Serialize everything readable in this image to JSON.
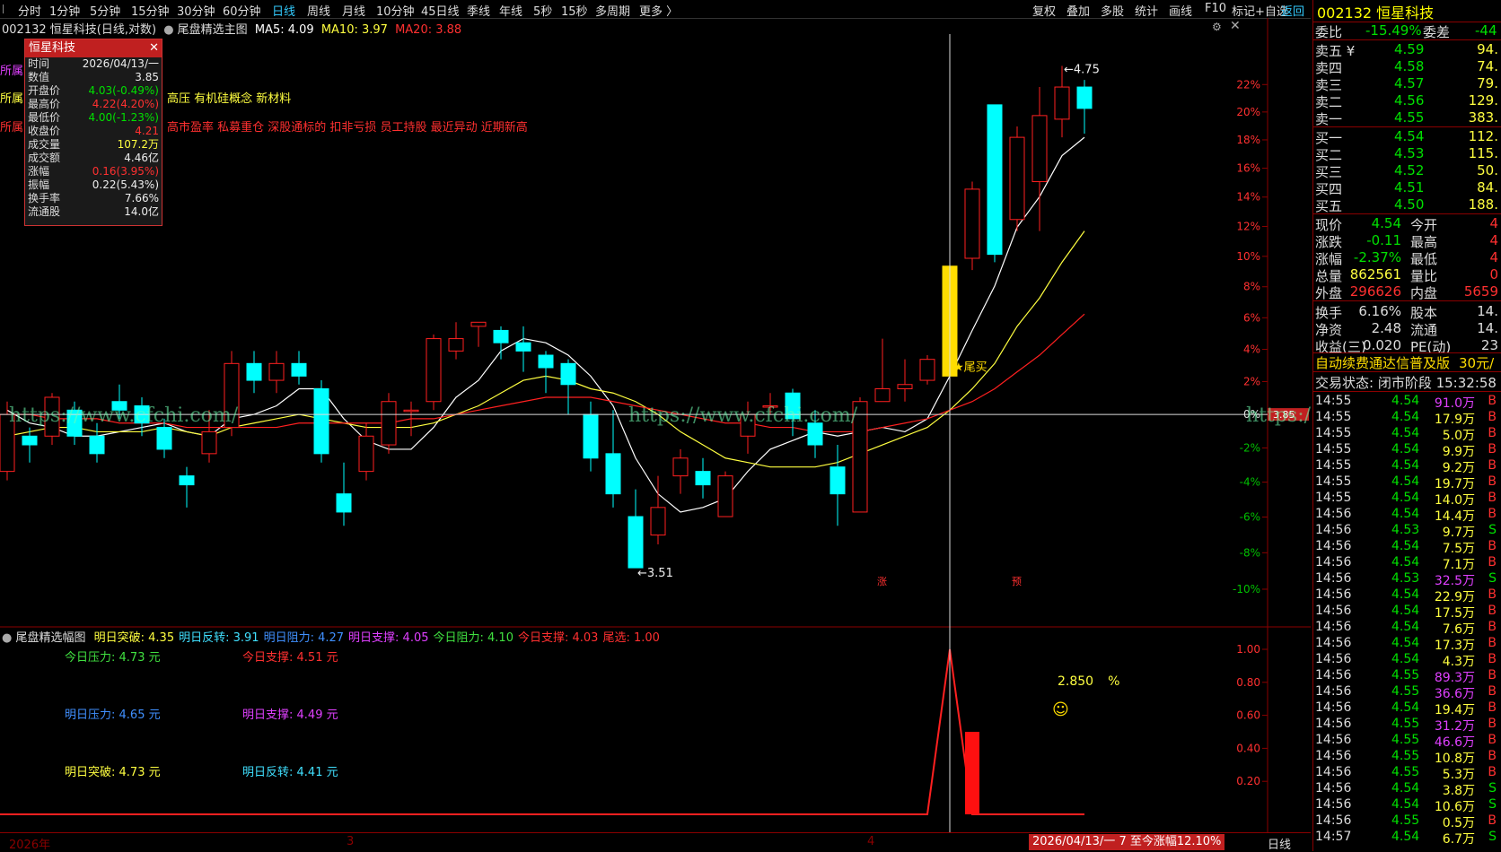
{
  "toolbar": {
    "periods": [
      "分时",
      "1分钟",
      "5分钟",
      "15分钟",
      "30分钟",
      "60分钟",
      "日线",
      "周线",
      "月线",
      "10分钟",
      "45日线",
      "季线",
      "年线",
      "5秒",
      "15秒",
      "多周期",
      "更多 〉"
    ],
    "active_index": 6,
    "right_items": [
      "复权",
      "叠加",
      "多股",
      "统计",
      "画线",
      "F10",
      "标记+自选",
      "返回"
    ]
  },
  "main": {
    "info": {
      "code_name": "002132 恒星科技(日线,对数)",
      "indicator": "尾盘精选主图",
      "ma5": "MA5: 4.09",
      "ma10": "MA10: 3.97",
      "ma20": "MA20: 3.88"
    },
    "popup": {
      "title": "恒星科技",
      "rows": [
        {
          "label": "时间",
          "value": "2026/04/13/一",
          "color": "#eee"
        },
        {
          "label": "数值",
          "value": "3.85",
          "color": "#eee"
        },
        {
          "label": "开盘价",
          "value": "4.03(-0.49%)",
          "color": "#00e000"
        },
        {
          "label": "最高价",
          "value": "4.22(4.20%)",
          "color": "#ff3030"
        },
        {
          "label": "最低价",
          "value": "4.00(-1.23%)",
          "color": "#00e000"
        },
        {
          "label": "收盘价",
          "value": "4.21",
          "color": "#ff3030"
        },
        {
          "label": "成交量",
          "value": "107.2万",
          "color": "#ffff40"
        },
        {
          "label": "成交额",
          "value": "4.46亿",
          "color": "#eee"
        },
        {
          "label": "涨幅",
          "value": "0.16(3.95%)",
          "color": "#ff3030"
        },
        {
          "label": "振幅",
          "value": "0.22(5.43%)",
          "color": "#eee"
        },
        {
          "label": "换手率",
          "value": "7.66%",
          "color": "#eee"
        },
        {
          "label": "流通股",
          "value": "14.0亿",
          "color": "#eee"
        }
      ]
    },
    "sector_lines": [
      {
        "text": "所属",
        "color": "#e040ff"
      },
      {
        "text": "所属",
        "color": "#ffff40",
        "suffix": "高压 有机硅概念 新材料"
      },
      {
        "text": "所属",
        "color": "#ff3030",
        "suffix": "高市盈率 私募重仓 深股通标的 扣非亏损 员工持股 最近异动 近期新高"
      }
    ],
    "high_label": "4.75",
    "low_label": "3.51",
    "buy_signal": "★尾买",
    "watermark": "https://www.cfchi.com/",
    "price_tag": "3.85",
    "marks": [
      "涨",
      "预"
    ],
    "y_axis_pct": [
      "22%",
      "20%",
      "18%",
      "16%",
      "14%",
      "12%",
      "10%",
      "8%",
      "6%",
      "4%",
      "2%",
      "0%",
      "-2%",
      "-4%",
      "-6%",
      "-8%",
      "-10%"
    ]
  },
  "chart_data": {
    "type": "candlestick",
    "title": "002132 恒星科技(日线,对数)",
    "xlabel": "",
    "ylabel": "",
    "candles": [
      {
        "o": 3.72,
        "c": 3.85,
        "h": 3.88,
        "l": 3.7
      },
      {
        "o": 3.8,
        "c": 3.78,
        "h": 3.82,
        "l": 3.74
      },
      {
        "o": 3.8,
        "c": 3.89,
        "h": 3.9,
        "l": 3.78
      },
      {
        "o": 3.86,
        "c": 3.8,
        "h": 3.88,
        "l": 3.78
      },
      {
        "o": 3.8,
        "c": 3.76,
        "h": 3.83,
        "l": 3.74
      },
      {
        "o": 3.88,
        "c": 3.86,
        "h": 3.92,
        "l": 3.84
      },
      {
        "o": 3.87,
        "c": 3.83,
        "h": 3.89,
        "l": 3.8
      },
      {
        "o": 3.82,
        "c": 3.77,
        "h": 3.84,
        "l": 3.75
      },
      {
        "o": 3.71,
        "c": 3.69,
        "h": 3.73,
        "l": 3.64
      },
      {
        "o": 3.76,
        "c": 3.81,
        "h": 3.86,
        "l": 3.74
      },
      {
        "o": 3.82,
        "c": 3.97,
        "h": 4.0,
        "l": 3.8
      },
      {
        "o": 3.97,
        "c": 3.93,
        "h": 4.0,
        "l": 3.9
      },
      {
        "o": 3.93,
        "c": 3.97,
        "h": 4.0,
        "l": 3.9
      },
      {
        "o": 3.97,
        "c": 3.94,
        "h": 4.0,
        "l": 3.92
      },
      {
        "o": 3.91,
        "c": 3.76,
        "h": 3.93,
        "l": 3.74
      },
      {
        "o": 3.67,
        "c": 3.63,
        "h": 3.74,
        "l": 3.6
      },
      {
        "o": 3.72,
        "c": 3.8,
        "h": 3.83,
        "l": 3.7
      },
      {
        "o": 3.78,
        "c": 3.88,
        "h": 3.9,
        "l": 3.76
      },
      {
        "o": 3.86,
        "c": 3.86,
        "h": 3.88,
        "l": 3.8
      },
      {
        "o": 3.88,
        "c": 4.03,
        "h": 4.04,
        "l": 3.86
      },
      {
        "o": 4.0,
        "c": 4.03,
        "h": 4.07,
        "l": 3.98
      },
      {
        "o": 4.06,
        "c": 4.07,
        "h": 4.07,
        "l": 4.01
      },
      {
        "o": 4.05,
        "c": 4.02,
        "h": 4.06,
        "l": 3.98
      },
      {
        "o": 4.02,
        "c": 4.0,
        "h": 4.06,
        "l": 3.95
      },
      {
        "o": 3.99,
        "c": 3.96,
        "h": 4.0,
        "l": 3.9
      },
      {
        "o": 3.97,
        "c": 3.92,
        "h": 3.98,
        "l": 3.85
      },
      {
        "o": 3.85,
        "c": 3.75,
        "h": 3.88,
        "l": 3.72
      },
      {
        "o": 3.76,
        "c": 3.67,
        "h": 3.86,
        "l": 3.64
      },
      {
        "o": 3.62,
        "c": 3.51,
        "h": 3.68,
        "l": 3.51
      },
      {
        "o": 3.58,
        "c": 3.64,
        "h": 3.71,
        "l": 3.56
      },
      {
        "o": 3.71,
        "c": 3.75,
        "h": 3.77,
        "l": 3.67
      },
      {
        "o": 3.72,
        "c": 3.69,
        "h": 3.75,
        "l": 3.66
      },
      {
        "o": 3.62,
        "c": 3.71,
        "h": 3.72,
        "l": 3.62
      },
      {
        "o": 3.8,
        "c": 3.85,
        "h": 3.88,
        "l": 3.76
      },
      {
        "o": 3.87,
        "c": 3.87,
        "h": 3.9,
        "l": 3.85
      },
      {
        "o": 3.9,
        "c": 3.84,
        "h": 3.91,
        "l": 3.8
      },
      {
        "o": 3.83,
        "c": 3.78,
        "h": 3.86,
        "l": 3.75
      },
      {
        "o": 3.73,
        "c": 3.67,
        "h": 3.78,
        "l": 3.6
      },
      {
        "o": 3.63,
        "c": 3.88,
        "h": 3.89,
        "l": 3.63
      },
      {
        "o": 3.88,
        "c": 3.91,
        "h": 4.03,
        "l": 3.88
      },
      {
        "o": 3.91,
        "c": 3.92,
        "h": 3.98,
        "l": 3.88
      },
      {
        "o": 3.93,
        "c": 3.98,
        "h": 3.99,
        "l": 3.92
      },
      {
        "o": 3.94,
        "c": 4.21,
        "h": 4.22,
        "l": 4.0
      },
      {
        "o": 4.23,
        "c": 4.41,
        "h": 4.43,
        "l": 4.2
      },
      {
        "o": 4.64,
        "c": 4.24,
        "h": 4.64,
        "l": 4.22
      },
      {
        "o": 4.33,
        "c": 4.55,
        "h": 4.58,
        "l": 4.3
      },
      {
        "o": 4.43,
        "c": 4.61,
        "h": 4.69,
        "l": 4.3
      },
      {
        "o": 4.6,
        "c": 4.69,
        "h": 4.75,
        "l": 4.55
      },
      {
        "o": 4.69,
        "c": 4.63,
        "h": 4.71,
        "l": 4.56
      }
    ],
    "ma5": [
      3.86,
      3.83,
      3.82,
      3.8,
      3.8,
      3.81,
      3.82,
      3.83,
      3.81,
      3.8,
      3.84,
      3.85,
      3.87,
      3.91,
      3.91,
      3.84,
      3.79,
      3.77,
      3.77,
      3.82,
      3.89,
      3.93,
      4.0,
      4.03,
      4.02,
      3.99,
      3.94,
      3.87,
      3.75,
      3.67,
      3.63,
      3.64,
      3.66,
      3.72,
      3.77,
      3.79,
      3.81,
      3.8,
      3.81,
      3.82,
      3.81,
      3.84,
      3.94,
      4.05,
      4.16,
      4.31,
      4.39,
      4.5,
      4.55
    ],
    "ma10": [
      3.8,
      3.81,
      3.82,
      3.82,
      3.81,
      3.81,
      3.81,
      3.82,
      3.81,
      3.8,
      3.82,
      3.83,
      3.84,
      3.85,
      3.84,
      3.83,
      3.82,
      3.82,
      3.82,
      3.83,
      3.85,
      3.87,
      3.9,
      3.93,
      3.94,
      3.93,
      3.91,
      3.9,
      3.88,
      3.85,
      3.81,
      3.78,
      3.75,
      3.74,
      3.73,
      3.73,
      3.73,
      3.74,
      3.76,
      3.78,
      3.8,
      3.82,
      3.86,
      3.91,
      3.97,
      4.06,
      4.13,
      4.22,
      4.3
    ],
    "ma20": [
      3.85,
      3.85,
      3.84,
      3.84,
      3.84,
      3.83,
      3.83,
      3.83,
      3.82,
      3.82,
      3.82,
      3.82,
      3.82,
      3.83,
      3.83,
      3.83,
      3.83,
      3.83,
      3.84,
      3.84,
      3.85,
      3.86,
      3.87,
      3.88,
      3.89,
      3.89,
      3.89,
      3.88,
      3.87,
      3.86,
      3.85,
      3.84,
      3.83,
      3.83,
      3.82,
      3.82,
      3.81,
      3.81,
      3.81,
      3.82,
      3.83,
      3.84,
      3.86,
      3.88,
      3.91,
      3.95,
      3.99,
      4.04,
      4.09
    ],
    "ylim": [
      3.45,
      4.85
    ],
    "x_labels": [
      "2026年",
      "3",
      "4"
    ]
  },
  "indicator": {
    "name": "尾盘精选幅图",
    "values": [
      {
        "text": "明日突破: 4.35",
        "color": "#ffff40"
      },
      {
        "text": "明日反转: 3.91",
        "color": "#40e0ff"
      },
      {
        "text": "明日阻力: 4.27",
        "color": "#4090ff"
      },
      {
        "text": "明日支撑: 4.05",
        "color": "#e040ff"
      },
      {
        "text": "今日阻力: 4.10",
        "color": "#40e040"
      },
      {
        "text": "今日支撑: 4.03",
        "color": "#ff3030"
      },
      {
        "text": "尾选: 1.00",
        "color": "#ff3030"
      }
    ],
    "levels": [
      {
        "label": "今日压力:",
        "value": "4.73 元",
        "color": "#40e040"
      },
      {
        "label": "今日支撑:",
        "value": "4.51 元",
        "color": "#ff3030"
      },
      {
        "label": "明日压力:",
        "value": "4.65 元",
        "color": "#4090ff"
      },
      {
        "label": "明日支撑:",
        "value": "4.49 元",
        "color": "#e040ff"
      },
      {
        "label": "明日突破:",
        "value": "4.73 元",
        "color": "#ffff40"
      },
      {
        "label": "明日反转:",
        "value": "4.41 元",
        "color": "#40e0ff"
      }
    ],
    "pct_text": "2.850",
    "pct_unit": "%",
    "smiley": "☺",
    "bar_value": 0.5,
    "y_axis": [
      "1.00",
      "0.80",
      "0.60",
      "0.40",
      "0.20"
    ],
    "bottom_range": "2026/04/13/一 7 至今涨幅12.10%",
    "period_label": "日线"
  },
  "right_panel": {
    "title": "002132 恒星科技",
    "wei_bi_label": "委比",
    "wei_bi": "-15.49%",
    "wei_cha_label": "委差",
    "wei_cha": "-44",
    "sells": [
      {
        "label": "卖五 ¥",
        "price": "4.59",
        "vol": "94."
      },
      {
        "label": "卖四",
        "price": "4.58",
        "vol": "74."
      },
      {
        "label": "卖三",
        "price": "4.57",
        "vol": "79."
      },
      {
        "label": "卖二",
        "price": "4.56",
        "vol": "129."
      },
      {
        "label": "卖一",
        "price": "4.55",
        "vol": "383."
      }
    ],
    "buys": [
      {
        "label": "买一",
        "price": "4.54",
        "vol": "112."
      },
      {
        "label": "买二",
        "price": "4.53",
        "vol": "115."
      },
      {
        "label": "买三",
        "price": "4.52",
        "vol": "50."
      },
      {
        "label": "买四",
        "price": "4.51",
        "vol": "84."
      },
      {
        "label": "买五",
        "price": "4.50",
        "vol": "188."
      }
    ],
    "quote": [
      {
        "l1": "现价",
        "v1": "4.54",
        "c1": "#00e000",
        "l2": "今开",
        "v2": "4"
      },
      {
        "l1": "涨跌",
        "v1": "-0.11",
        "c1": "#00e000",
        "l2": "最高",
        "v2": "4"
      },
      {
        "l1": "涨幅",
        "v1": "-2.37%",
        "c1": "#00e000",
        "l2": "最低",
        "v2": "4"
      },
      {
        "l1": "总量",
        "v1": "862561",
        "c1": "#ffff40",
        "l2": "量比",
        "v2": "0"
      },
      {
        "l1": "外盘",
        "v1": "296626",
        "c1": "#ff3030",
        "l2": "内盘",
        "v2": "5659"
      }
    ],
    "stats": [
      {
        "l1": "换手",
        "v1": "6.16%",
        "l2": "股本",
        "v2": "14."
      },
      {
        "l1": "净资",
        "v1": "2.48",
        "l2": "流通",
        "v2": "14."
      },
      {
        "l1": "收益(三)",
        "v1": "0.020",
        "l2": "PE(动)",
        "v2": "23"
      }
    ],
    "promo": "自动续费通达信普及版",
    "promo_price": "30元/",
    "status": "交易状态: 闭市阶段 15:32:58",
    "ticks": [
      {
        "t": "14:55",
        "p": "4.54",
        "v": "91.0万",
        "s": "B"
      },
      {
        "t": "14:55",
        "p": "4.54",
        "v": "17.9万",
        "s": "B"
      },
      {
        "t": "14:55",
        "p": "4.54",
        "v": "5.0万",
        "s": "B"
      },
      {
        "t": "14:55",
        "p": "4.54",
        "v": "9.9万",
        "s": "B"
      },
      {
        "t": "14:55",
        "p": "4.54",
        "v": "9.2万",
        "s": "B"
      },
      {
        "t": "14:55",
        "p": "4.54",
        "v": "19.7万",
        "s": "B"
      },
      {
        "t": "14:55",
        "p": "4.54",
        "v": "14.0万",
        "s": "B"
      },
      {
        "t": "14:56",
        "p": "4.54",
        "v": "14.4万",
        "s": "B"
      },
      {
        "t": "14:56",
        "p": "4.53",
        "v": "9.7万",
        "s": "S"
      },
      {
        "t": "14:56",
        "p": "4.54",
        "v": "7.5万",
        "s": "B"
      },
      {
        "t": "14:56",
        "p": "4.54",
        "v": "7.1万",
        "s": "B"
      },
      {
        "t": "14:56",
        "p": "4.53",
        "v": "32.5万",
        "s": "S"
      },
      {
        "t": "14:56",
        "p": "4.54",
        "v": "22.9万",
        "s": "B"
      },
      {
        "t": "14:56",
        "p": "4.54",
        "v": "17.5万",
        "s": "B"
      },
      {
        "t": "14:56",
        "p": "4.54",
        "v": "7.6万",
        "s": "B"
      },
      {
        "t": "14:56",
        "p": "4.54",
        "v": "17.3万",
        "s": "B"
      },
      {
        "t": "14:56",
        "p": "4.54",
        "v": "4.3万",
        "s": "B"
      },
      {
        "t": "14:56",
        "p": "4.55",
        "v": "89.3万",
        "s": "B"
      },
      {
        "t": "14:56",
        "p": "4.55",
        "v": "36.6万",
        "s": "B"
      },
      {
        "t": "14:56",
        "p": "4.54",
        "v": "19.4万",
        "s": "B"
      },
      {
        "t": "14:56",
        "p": "4.55",
        "v": "31.2万",
        "s": "B"
      },
      {
        "t": "14:56",
        "p": "4.55",
        "v": "46.6万",
        "s": "B"
      },
      {
        "t": "14:56",
        "p": "4.55",
        "v": "10.8万",
        "s": "B"
      },
      {
        "t": "14:56",
        "p": "4.55",
        "v": "5.3万",
        "s": "B"
      },
      {
        "t": "14:56",
        "p": "4.54",
        "v": "3.8万",
        "s": "S"
      },
      {
        "t": "14:56",
        "p": "4.54",
        "v": "10.6万",
        "s": "S"
      },
      {
        "t": "14:56",
        "p": "4.55",
        "v": "0.5万",
        "s": "B"
      },
      {
        "t": "14:57",
        "p": "4.54",
        "v": "6.7万",
        "s": "S"
      }
    ]
  }
}
